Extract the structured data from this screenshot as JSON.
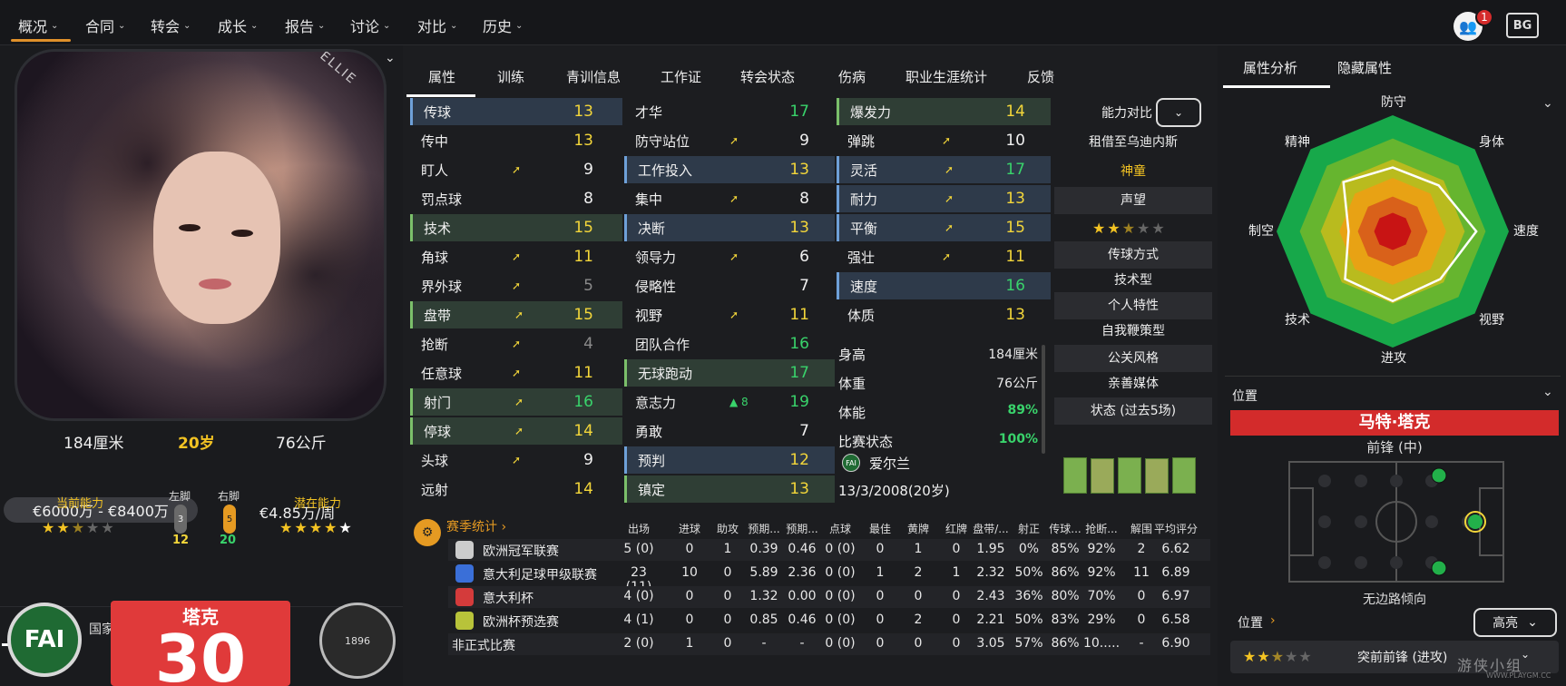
{
  "nav": {
    "items": [
      "概况",
      "合同",
      "转会",
      "成长",
      "报告",
      "讨论",
      "对比",
      "历史"
    ],
    "notification_count": "1",
    "bg_label": "BG"
  },
  "player": {
    "portrait_watermark": "ELLIE",
    "height": "184厘米",
    "age": "20岁",
    "weight": "76公斤",
    "value": "€6000万 - €8400万",
    "wage": "€4.85万/周",
    "current_ability_label": "当前能力",
    "potential_ability_label": "潜在能力",
    "left_foot_label": "左脚",
    "right_foot_label": "右脚",
    "left_foot_pill": "3",
    "right_foot_pill": "5",
    "left_foot_value": "12",
    "right_foot_value": "20",
    "current_ability_stars": 2.5,
    "potential_ability_stars": 4.5
  },
  "bottom_tabs": [
    "概况",
    "国家/地区"
  ],
  "badges": {
    "fai": "FAI",
    "shirt_name": "塔克",
    "shirt_number": "30",
    "club": "1896"
  },
  "attr_tabs": [
    "属性",
    "训练",
    "青训信息",
    "工作证",
    "转会状态",
    "伤病",
    "职业生涯统计",
    "反馈"
  ],
  "attributes": {
    "technical": [
      {
        "name": "传球",
        "value": "13",
        "color": "yellow",
        "hl": "blue",
        "arrow": false
      },
      {
        "name": "传中",
        "value": "13",
        "color": "yellow",
        "hl": "",
        "arrow": false
      },
      {
        "name": "盯人",
        "value": "9",
        "color": "white",
        "hl": "",
        "arrow": true
      },
      {
        "name": "罚点球",
        "value": "8",
        "color": "white",
        "hl": "",
        "arrow": false
      },
      {
        "name": "技术",
        "value": "15",
        "color": "yellow",
        "hl": "green",
        "arrow": false
      },
      {
        "name": "角球",
        "value": "11",
        "color": "yellow",
        "hl": "",
        "arrow": true
      },
      {
        "name": "界外球",
        "value": "5",
        "color": "grey",
        "hl": "",
        "arrow": true
      },
      {
        "name": "盘带",
        "value": "15",
        "color": "yellow",
        "hl": "green",
        "arrow": true
      },
      {
        "name": "抢断",
        "value": "4",
        "color": "grey",
        "hl": "",
        "arrow": true
      },
      {
        "name": "任意球",
        "value": "11",
        "color": "yellow",
        "hl": "",
        "arrow": true
      },
      {
        "name": "射门",
        "value": "16",
        "color": "green",
        "hl": "green",
        "arrow": true
      },
      {
        "name": "停球",
        "value": "14",
        "color": "yellow",
        "hl": "green",
        "arrow": true
      },
      {
        "name": "头球",
        "value": "9",
        "color": "white",
        "hl": "",
        "arrow": true
      },
      {
        "name": "远射",
        "value": "14",
        "color": "yellow",
        "hl": "",
        "arrow": false
      }
    ],
    "mental": [
      {
        "name": "才华",
        "value": "17",
        "color": "green",
        "hl": "",
        "arrow": false
      },
      {
        "name": "防守站位",
        "value": "9",
        "color": "white",
        "hl": "",
        "arrow": true
      },
      {
        "name": "工作投入",
        "value": "13",
        "color": "yellow",
        "hl": "blue",
        "arrow": false
      },
      {
        "name": "集中",
        "value": "8",
        "color": "white",
        "hl": "",
        "arrow": true
      },
      {
        "name": "决断",
        "value": "13",
        "color": "yellow",
        "hl": "blue",
        "arrow": false
      },
      {
        "name": "领导力",
        "value": "6",
        "color": "white",
        "hl": "",
        "arrow": true
      },
      {
        "name": "侵略性",
        "value": "7",
        "color": "white",
        "hl": "",
        "arrow": false
      },
      {
        "name": "视野",
        "value": "11",
        "color": "yellow",
        "hl": "",
        "arrow": true
      },
      {
        "name": "团队合作",
        "value": "16",
        "color": "green",
        "hl": "",
        "arrow": false
      },
      {
        "name": "无球跑动",
        "value": "17",
        "color": "green",
        "hl": "green",
        "arrow": false
      },
      {
        "name": "意志力",
        "value": "19",
        "color": "green",
        "hl": "",
        "arrow": false,
        "up": "8"
      },
      {
        "name": "勇敢",
        "value": "7",
        "color": "white",
        "hl": "",
        "arrow": false
      },
      {
        "name": "预判",
        "value": "12",
        "color": "yellow",
        "hl": "blue",
        "arrow": false
      },
      {
        "name": "镇定",
        "value": "13",
        "color": "yellow",
        "hl": "green",
        "arrow": false
      }
    ],
    "physical": [
      {
        "name": "爆发力",
        "value": "14",
        "color": "yellow",
        "hl": "green",
        "arrow": false
      },
      {
        "name": "弹跳",
        "value": "10",
        "color": "white",
        "hl": "",
        "arrow": true
      },
      {
        "name": "灵活",
        "value": "17",
        "color": "green",
        "hl": "blue",
        "arrow": true
      },
      {
        "name": "耐力",
        "value": "13",
        "color": "yellow",
        "hl": "blue",
        "arrow": true
      },
      {
        "name": "平衡",
        "value": "15",
        "color": "yellow",
        "hl": "blue",
        "arrow": true
      },
      {
        "name": "强壮",
        "value": "11",
        "color": "yellow",
        "hl": "",
        "arrow": true
      },
      {
        "name": "速度",
        "value": "16",
        "color": "green",
        "hl": "blue",
        "arrow": false
      },
      {
        "name": "体质",
        "value": "13",
        "color": "yellow",
        "hl": "",
        "arrow": false
      }
    ]
  },
  "info": {
    "height_label": "身高",
    "height": "184厘米",
    "weight_label": "体重",
    "weight": "76公斤",
    "fitness_label": "体能",
    "fitness": "89%",
    "match_label": "比赛状态",
    "match": "100%",
    "nation": "爱尔兰",
    "dob": "13/3/2008(20岁)"
  },
  "compare": {
    "title": "能力对比",
    "loan": "租借至乌迪内斯",
    "tag": "神童",
    "reputation_label": "声望",
    "reputation_stars": 2.5,
    "passing_label": "传球方式",
    "passing": "技术型",
    "trait_label": "个人特性",
    "trait": "自我鞭策型",
    "media_label": "公关风格",
    "media": "亲善媒体",
    "form_label": "状态 (过去5场)",
    "form_ratings": [
      7.1,
      7.0,
      7.1,
      7.0,
      7.1
    ]
  },
  "season": {
    "title": "赛季统计",
    "headers": [
      "出场",
      "进球",
      "助攻",
      "预期...",
      "预期...",
      "点球",
      "最佳",
      "黄牌",
      "红牌",
      "盘带/...",
      "射正",
      "传球...",
      "抢断...",
      "解围",
      "平均评分"
    ],
    "rows": [
      {
        "comp": "欧洲冠军联赛",
        "icon": "#ccc",
        "cells": [
          "5 (0)",
          "0",
          "1",
          "0.39",
          "0.46",
          "0 (0)",
          "0",
          "1",
          "0",
          "1.95",
          "0%",
          "85%",
          "92%",
          "2",
          "6.62"
        ]
      },
      {
        "comp": "意大利足球甲级联赛",
        "icon": "#3a6fd8",
        "cells": [
          "23 (11)",
          "10",
          "0",
          "5.89",
          "2.36",
          "0 (0)",
          "1",
          "2",
          "1",
          "2.32",
          "50%",
          "86%",
          "92%",
          "11",
          "6.89"
        ]
      },
      {
        "comp": "意大利杯",
        "icon": "#d43b3b",
        "cells": [
          "4 (0)",
          "0",
          "0",
          "1.32",
          "0.00",
          "0 (0)",
          "0",
          "0",
          "0",
          "2.43",
          "36%",
          "80%",
          "70%",
          "0",
          "6.97"
        ]
      },
      {
        "comp": "欧洲杯预选赛",
        "icon": "#b8c33a",
        "cells": [
          "4 (1)",
          "0",
          "0",
          "0.85",
          "0.46",
          "0 (0)",
          "0",
          "2",
          "0",
          "2.21",
          "50%",
          "83%",
          "29%",
          "0",
          "6.58"
        ]
      },
      {
        "comp": "非正式比赛",
        "icon": "",
        "cells": [
          "2 (0)",
          "1",
          "0",
          "-",
          "-",
          "0 (0)",
          "0",
          "0",
          "0",
          "3.05",
          "57%",
          "86%",
          "10.....",
          "-",
          "6.90"
        ]
      }
    ]
  },
  "right": {
    "tabs": [
      "属性分析",
      "隐藏属性"
    ],
    "radar_labels": {
      "top": "防守",
      "tr": "身体",
      "right": "速度",
      "br": "视野",
      "bottom": "进攻",
      "bl": "技术",
      "left": "制空",
      "tl": "精神"
    },
    "radar_values": [
      0.55,
      0.56,
      0.72,
      0.58,
      0.6,
      0.58,
      0.38,
      0.6
    ],
    "position_title": "位置",
    "player_name": "马特·塔克",
    "role": "前锋 (中)",
    "lean": "无边路倾向",
    "position2": "位置",
    "highlight": "高亮",
    "role_name": "突前前锋 (进攻)",
    "role_stars": 2.5,
    "watermark": "游侠小组",
    "watermark_sub": "WWW.PLAYGM.CC"
  },
  "colors": {
    "accent": "#e0902a",
    "yellow": "#f3d63a",
    "green": "#39d36b",
    "red": "#d32b2b"
  }
}
